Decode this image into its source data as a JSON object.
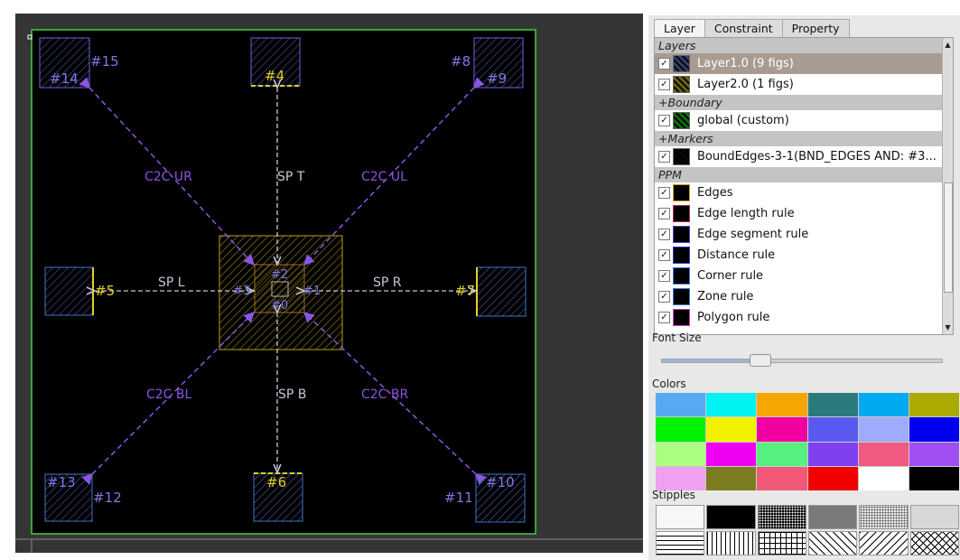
{
  "canvas": {
    "background": "#000000",
    "boundary_color": "#3ecf3e",
    "figure_color": "#6e63dc",
    "highlight_color": "#e2d020",
    "center_color": "#b8a214",
    "rule_arrow_color": "#8a55e0",
    "spacing_arrow_color": "#c8c8d8",
    "shape_labels": {
      "s14": "#14",
      "s15": "#15",
      "s4": "#4",
      "s8": "#8",
      "s9": "#9",
      "s5": "#5",
      "s7": "#7",
      "s3": "#3",
      "s1": "#1",
      "s2": "#2",
      "s0": "#0",
      "s13": "#13",
      "s12": "#12",
      "s6": "#6",
      "s11": "#11",
      "s10": "#10"
    },
    "rule_labels": {
      "c2c_ur": "C2C UR",
      "sp_t": "SP T",
      "c2c_ul": "C2C UL",
      "sp_l": "SP L",
      "sp_r": "SP R",
      "c2c_bl": "C2C BL",
      "sp_b": "SP B",
      "c2c_br": "C2C BR"
    }
  },
  "panel": {
    "tabs": [
      "Layer",
      "Constraint",
      "Property"
    ],
    "active_tab": "Layer",
    "groups": {
      "layers": "Layers",
      "boundary": "Boundary",
      "markers": "Markers",
      "ppm": "PPM",
      "expand_symbol": "+"
    },
    "check_symbol": "✓",
    "rows": {
      "layer1": {
        "label": "Layer1.0 (9 figs)",
        "swatch": "#32406e",
        "checked": true,
        "selected": true
      },
      "layer2": {
        "label": "Layer2.0 (1 figs)",
        "swatch": "#6b6410",
        "checked": true
      },
      "global": {
        "label": "global (custom)",
        "swatch": "#0f6a0f",
        "checked": true
      },
      "bound_edges": {
        "label": "BoundEdges-3-1(BND_EDGES AND: #3...",
        "swatch": "#000000",
        "checked": true
      },
      "edges": {
        "label": "Edges",
        "border": "#c8a010",
        "checked": true
      },
      "edge_length": {
        "label": "Edge length rule",
        "border": "#b03050",
        "checked": true
      },
      "edge_segment": {
        "label": "Edge segment rule",
        "border": "#5a3cc0",
        "checked": true
      },
      "distance": {
        "label": "Distance rule",
        "border": "#3040b8",
        "checked": true
      },
      "corner": {
        "label": "Corner rule",
        "border": "#3c70d8",
        "checked": true
      },
      "zone": {
        "label": "Zone rule",
        "border": "#3c78c8",
        "checked": true
      },
      "polygon": {
        "label": "Polygon rule",
        "border": "#c040c0",
        "checked": true
      }
    },
    "font_size_label": "Font Size",
    "font_size_level": 0.33,
    "colors_label": "Colors",
    "colors": [
      "#57a9f2",
      "#00f2f2",
      "#f5a600",
      "#2a7c7c",
      "#00aaf0",
      "#aaaa00",
      "#00f200",
      "#f2f200",
      "#f000a0",
      "#5a5af0",
      "#a0aaff",
      "#0000f0",
      "#aaff80",
      "#f000f0",
      "#55f080",
      "#8040f0",
      "#f05a80",
      "#a050f0",
      "#f0a0f0",
      "#7c7c20",
      "#f05a78",
      "#f00000",
      "#ffffff",
      "#000000"
    ],
    "stipples_label": "Stipples",
    "stipples": [
      "blank",
      "solid",
      "dots-dense",
      "gray",
      "dots-light",
      "dots-fine",
      "hlines",
      "vlines",
      "grid",
      "diag-right",
      "diag-left",
      "crosshatch"
    ]
  }
}
